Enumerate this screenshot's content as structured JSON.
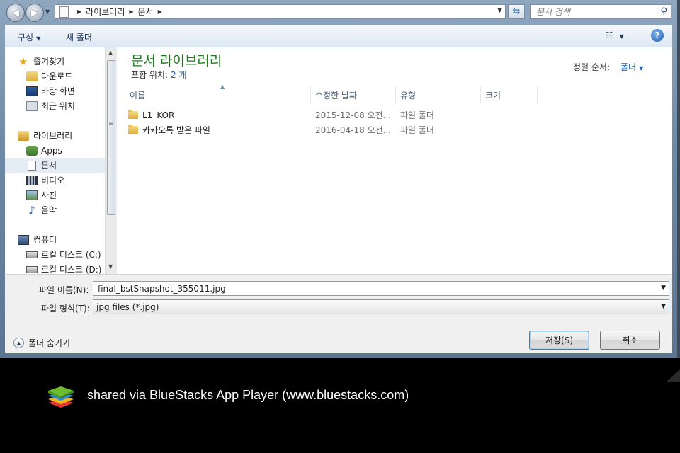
{
  "address": {
    "crumbs": [
      "라이브러리",
      "문서"
    ],
    "search_placeholder": "문서 검색"
  },
  "toolbar": {
    "organize_label": "구성",
    "new_folder_label": "새 폴더"
  },
  "nav": {
    "favorites_label": "즐겨찾기",
    "favorites": [
      {
        "label": "다운로드",
        "icon": "download-folder-icon"
      },
      {
        "label": "바탕 화면",
        "icon": "desktop-icon"
      },
      {
        "label": "최근 위치",
        "icon": "recent-places-icon"
      }
    ],
    "libraries_label": "라이브러리",
    "libraries": [
      {
        "label": "Apps",
        "icon": "apps-icon"
      },
      {
        "label": "문서",
        "icon": "documents-icon",
        "selected": true
      },
      {
        "label": "비디오",
        "icon": "video-icon"
      },
      {
        "label": "사진",
        "icon": "pictures-icon"
      },
      {
        "label": "음악",
        "icon": "music-icon"
      }
    ],
    "computer_label": "컴퓨터",
    "drives": [
      {
        "label": "로컬 디스크 (C:)",
        "icon": "disk-icon"
      },
      {
        "label": "로컬 디스크 (D:)",
        "icon": "disk-icon"
      }
    ]
  },
  "library": {
    "title": "문서 라이브러리",
    "includes_label": "포함 위치:",
    "includes_value": "2 개",
    "sort_label": "정렬 순서:",
    "sort_value": "폴더"
  },
  "columns": [
    "이름",
    "수정한 날짜",
    "유형",
    "크기"
  ],
  "files": [
    {
      "name": "L1_KOR",
      "modified": "2015-12-08 오전...",
      "type": "파일 폴더"
    },
    {
      "name": "카카오톡 받은 파일",
      "modified": "2016-04-18 오전...",
      "type": "파일 폴더"
    }
  ],
  "form": {
    "filename_label": "파일 이름(N):",
    "filename_value": "final_bstSnapshot_355011.jpg",
    "filetype_label": "파일 형식(T):",
    "filetype_value": "jpg files (*.jpg)",
    "hide_folders_label": "폴더 숨기기",
    "save_label": "저장(S)",
    "cancel_label": "취소"
  },
  "footer": {
    "share_text": "shared via BlueStacks App Player (www.bluestacks.com)"
  }
}
